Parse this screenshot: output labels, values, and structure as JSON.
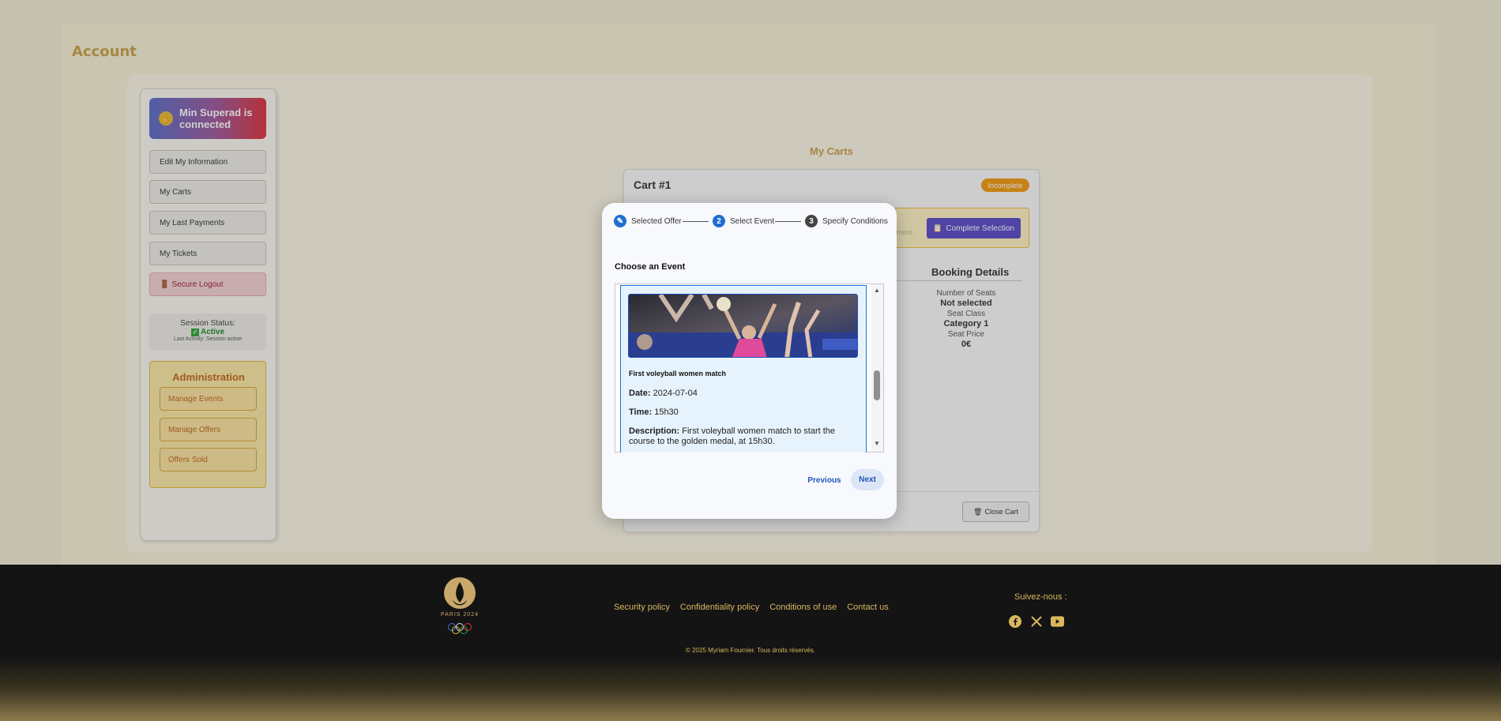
{
  "page": {
    "title": "Account"
  },
  "sidebar": {
    "connected_label": "Min Superad is connected",
    "menu": [
      {
        "label": "Edit My Information"
      },
      {
        "label": "My Carts"
      },
      {
        "label": "My Last Payments"
      },
      {
        "label": "My Tickets"
      },
      {
        "label": "Secure Logout"
      }
    ],
    "session": {
      "status_label": "Session Status:",
      "status_value": "Active",
      "last_activity": "Last Activity: Session active"
    },
    "admin": {
      "title": "Administration",
      "buttons": [
        {
          "label": "Manage Events"
        },
        {
          "label": "Manage Offers"
        },
        {
          "label": "Offers Sold"
        }
      ]
    }
  },
  "carts": {
    "title": "My Carts",
    "cart": {
      "title": "Cart #1",
      "badge": "Incomplete",
      "notice_fragment": "ayment.",
      "complete_button": "Complete Selection",
      "booking": {
        "title": "Booking Details",
        "seats_label": "Number of Seats",
        "seats_value": "Not selected",
        "class_label": "Seat Class",
        "class_value": "Category 1",
        "price_label": "Seat Price",
        "price_value": "0€"
      },
      "close_button": "Close Cart"
    }
  },
  "modal": {
    "steps": [
      {
        "label": "Selected Offer",
        "icon": "✎"
      },
      {
        "label": "Select Event",
        "icon": "2"
      },
      {
        "label": "Specify Conditions",
        "icon": "3"
      }
    ],
    "heading": "Choose an Event",
    "event": {
      "name": "First voleyball women match",
      "date_label": "Date:",
      "date": "2024-07-04",
      "time_label": "Time:",
      "time": "15h30",
      "description_label": "Description:",
      "description": "First voleyball women match to start the course to the golden medal, at 15h30."
    },
    "previous": "Previous",
    "next": "Next"
  },
  "footer": {
    "logo_text": "PARIS 2024",
    "links": [
      "Security policy",
      "Confidentiality policy",
      "Conditions of use",
      "Contact us"
    ],
    "follow": "Suivez-nous :",
    "social": [
      "facebook-icon",
      "x-icon",
      "youtube-icon"
    ],
    "copyright": "© 2025 Myriam Fournier. Tous droits réservés."
  },
  "colors": {
    "gold": "#d8b75e",
    "step_active": "#1e6fd1",
    "badge": "#f39c12"
  }
}
